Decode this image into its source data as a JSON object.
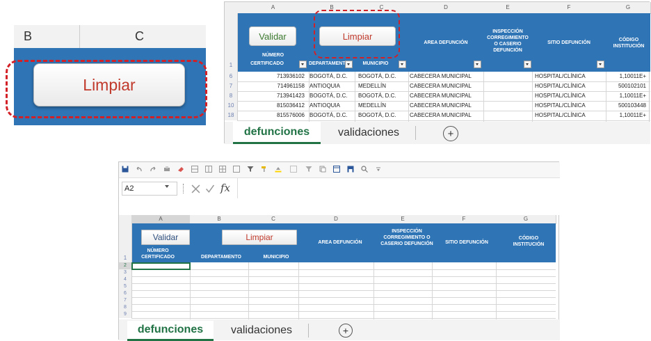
{
  "zoom": {
    "columns": [
      "B",
      "C"
    ],
    "button_label": "Limpiar"
  },
  "sheet_filled": {
    "columns": [
      "A",
      "B",
      "C",
      "D",
      "E",
      "F",
      "G"
    ],
    "buttons": {
      "validar": "Validar",
      "limpiar": "Limpiar"
    },
    "header_row_num": "1",
    "headers": {
      "numero": "NÚMERO",
      "certificado": "CERTIFICADO",
      "departamento": "DEPARTAMENT",
      "municipio": "MUNICIPIO",
      "area": "AREA DEFUNCIÓN",
      "inspeccion": "INSPECCIÓN CORREGIMIENTO O CASERIO DEFUNCIÓN",
      "sitio": "SITIO DEFUNCIÓN",
      "codigo": "CÓDIGO INSTITUCIÓN"
    },
    "rows": [
      {
        "num": "6",
        "certificado": "713936102",
        "departamento": "BOGOTÁ, D.C.",
        "municipio": "BOGOTÁ, D.C.",
        "area": "CABECERA MUNICIPAL",
        "sitio": "HOSPITAL/CLÍNICA",
        "codigo": "1,10011E+"
      },
      {
        "num": "7",
        "certificado": "714961158",
        "departamento": "ANTIOQUIA",
        "municipio": "MEDELLÍN",
        "area": "CABECERA MUNICIPAL",
        "sitio": "HOSPITAL/CLÍNICA",
        "codigo": "500102101"
      },
      {
        "num": "8",
        "certificado": "713941423",
        "departamento": "BOGOTÁ, D.C.",
        "municipio": "BOGOTÁ, D.C.",
        "area": "CABECERA MUNICIPAL",
        "sitio": "HOSPITAL/CLÍNICA",
        "codigo": "1,10011E+"
      },
      {
        "num": "10",
        "certificado": "815036412",
        "departamento": "ANTIOQUIA",
        "municipio": "MEDELLÍN",
        "area": "CABECERA MUNICIPAL",
        "sitio": "HOSPITAL/CLÍNICA",
        "codigo": "500103448"
      },
      {
        "num": "18",
        "certificado": "815576006",
        "departamento": "BOGOTÁ, D.C.",
        "municipio": "BOGOTÁ, D.C.",
        "area": "CABECERA MUNICIPAL",
        "sitio": "HOSPITAL/CLÍNICA",
        "codigo": "1,10011E+"
      }
    ],
    "tabs": [
      "defunciones",
      "validaciones"
    ],
    "add_sheet": "+"
  },
  "sheet_empty": {
    "name_box": "A2",
    "fx": "fx",
    "columns": [
      "A",
      "B",
      "C",
      "D",
      "E",
      "F",
      "G"
    ],
    "buttons": {
      "validar": "Validar",
      "limpiar": "Limpiar"
    },
    "headers": {
      "numero_certificado": "NÚMERO CERTIFICADO",
      "departamento": "DEPARTAMENTO",
      "municipio": "MUNICIPIO",
      "area": "AREA DEFUNCIÓN",
      "inspeccion": "INSPECCIÓN CORREGIMIENTO O CASERIO DEFUNCIÓN",
      "sitio": "SITIO DEFUNCIÓN",
      "codigo": "CÓDIGO INSTITUCIÓN"
    },
    "row_numbers": [
      "1",
      "2",
      "3",
      "4",
      "5",
      "6",
      "7",
      "8",
      "9"
    ],
    "tabs": [
      "defunciones",
      "validaciones"
    ],
    "add_sheet": "+"
  },
  "colors": {
    "header_blue": "#2f74b5",
    "validar_green": "#3c7a2f",
    "limpiar_red": "#c0392b",
    "tab_green": "#217346",
    "highlight_red": "#d32027"
  }
}
